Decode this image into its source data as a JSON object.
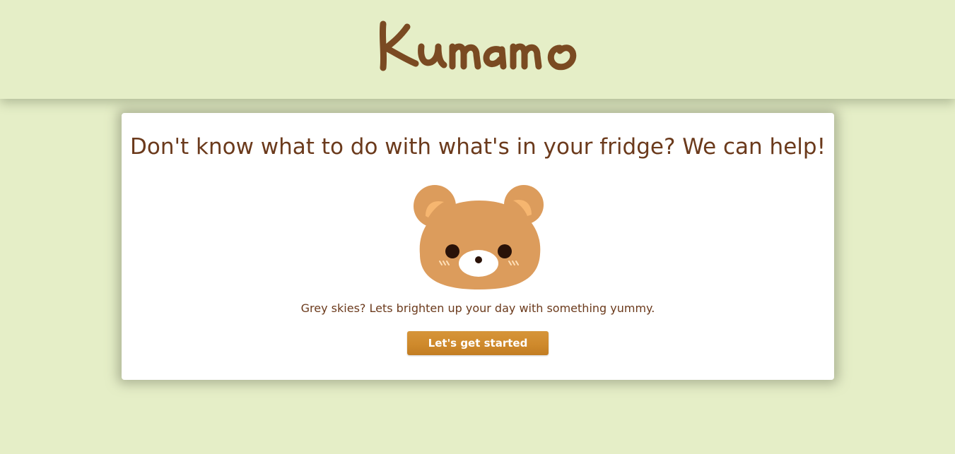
{
  "header": {
    "brand": "Kumamo",
    "brand_color": "#7a4a22"
  },
  "hero": {
    "headline": "Don't know what to do with what's in your fridge? We can help!",
    "tagline": "Grey skies? Lets brighten up your day with something yummy.",
    "cta_label": "Let's get started",
    "mascot_icon": "bear-face-icon"
  },
  "colors": {
    "page_background": "#e5eec7",
    "text_brown": "#6b3a1c",
    "button_orange": "#cf8a2c",
    "bear_fur": "#dc9c5c"
  }
}
